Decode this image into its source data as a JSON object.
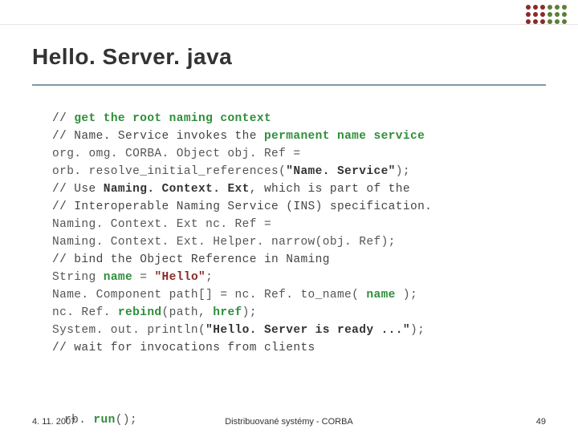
{
  "accent_colors": [
    "#8a2a2a",
    "#2f8e3b",
    "#5b7f36",
    "#7f9aa8",
    "#333333"
  ],
  "title": "Hello. Server. java",
  "code": {
    "l1a": "// ",
    "l1b": "get the root naming context",
    "l2a": "// Name. Service invokes the ",
    "l2b": "permanent name service",
    "l3": "org. omg. CORBA. Object obj. Ref =",
    "l4a": "        orb. resolve_initial_references(",
    "l4b": "\"Name. Service\"",
    "l4c": ");",
    "l5a": "// Use ",
    "l5b": "Naming. Context. Ext",
    "l5c": ", which is part of the",
    "l6": "// Interoperable Naming Service (INS) specification.",
    "l7": "Naming. Context. Ext nc. Ref =",
    "l8": "        Naming. Context. Ext. Helper. narrow(obj. Ref);",
    "l9": "// bind the Object Reference in Naming",
    "l10a": "String ",
    "l10b": "name",
    "l10c": " = ",
    "l10d": "\"Hello\"",
    "l10e": ";",
    "l11a": "Name. Component path[] = nc. Ref. to_name( ",
    "l11b": "name",
    "l11c": " );",
    "l12a": "nc. Ref. ",
    "l12b": "rebind",
    "l12c": "(path, ",
    "l12d": "href",
    "l12e": ");",
    "l13a": "System. out. println(",
    "l13b": "\"Hello. Server is ready ...\"",
    "l13c": ");",
    "l14": "// wait for invocations from clients",
    "l15a": "rb. ",
    "l15b": "run",
    "l15c": "();"
  },
  "footer": {
    "date": "4. 11. 2007",
    "middle": "Distribuované systémy - CORBA",
    "page": "49"
  }
}
